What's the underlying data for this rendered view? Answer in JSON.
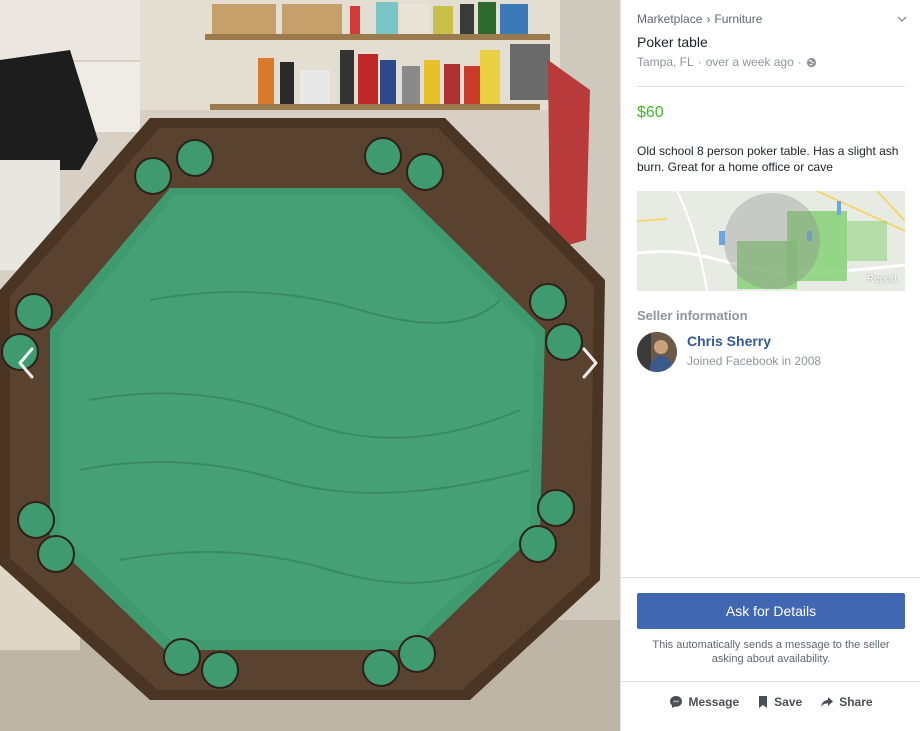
{
  "photo": {
    "description_icon": "photo-poker-table",
    "prev_icon": "chevron-left-icon",
    "next_icon": "chevron-right-icon"
  },
  "breadcrumb": {
    "root": "Marketplace",
    "separator": "›",
    "category": "Furniture"
  },
  "listing": {
    "title": "Poker table",
    "location": "Tampa, FL",
    "dot": "·",
    "posted": "over a week ago",
    "price": "$60",
    "description": "Old school 8 person poker table. Has a slight ash burn. Great for a home office or cave"
  },
  "map": {
    "report_label": "Report"
  },
  "seller": {
    "heading": "Seller information",
    "name": "Chris Sherry",
    "joined": "Joined Facebook in 2008"
  },
  "cta": {
    "ask_label": "Ask for Details",
    "note": "This automatically sends a message to the seller asking about availability."
  },
  "actions": {
    "message": "Message",
    "save": "Save",
    "share": "Share"
  },
  "colors": {
    "accent": "#4267b2",
    "price": "#42b72a",
    "link": "#365899",
    "felt": "#3f9a6f"
  }
}
